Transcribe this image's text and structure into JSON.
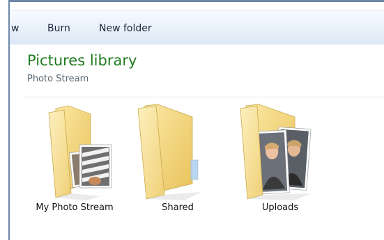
{
  "toolbar": {
    "partial_label": "w",
    "burn_label": "Burn",
    "new_folder_label": "New folder"
  },
  "library": {
    "title": "Pictures library",
    "subtitle": "Photo Stream"
  },
  "folders": [
    {
      "label": "My Photo Stream",
      "icon": "folder-with-photos-icon"
    },
    {
      "label": "Shared",
      "icon": "folder-icon"
    },
    {
      "label": "Uploads",
      "icon": "folder-with-portraits-icon"
    }
  ],
  "colors": {
    "title_green": "#1e7a1e",
    "folder_yellow": "#f5d97a",
    "toolbar_blue": "#e8f0fa"
  }
}
